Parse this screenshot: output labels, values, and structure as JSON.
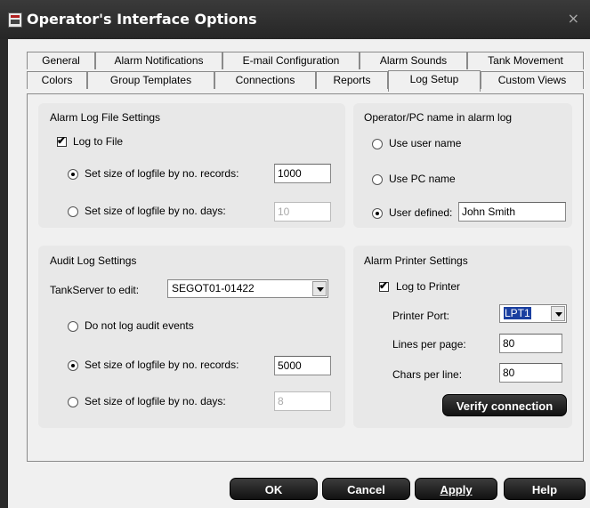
{
  "window": {
    "title": "Operator's Interface Options",
    "close_label": "×"
  },
  "tabs_top": [
    "General",
    "Alarm Notifications",
    "E-mail Configuration",
    "Alarm Sounds",
    "Tank Movement"
  ],
  "tabs_bottom": [
    "Colors",
    "Group Templates",
    "Connections",
    "Reports",
    "Log Setup",
    "Custom Views"
  ],
  "active_tab": "Log Setup",
  "alarm_log": {
    "heading": "Alarm Log File Settings",
    "log_to_file_label": "Log to File",
    "log_to_file_checked": true,
    "by_records_label": "Set size of logfile by no. records:",
    "by_records_value": "1000",
    "by_days_label": "Set size of logfile by no. days:",
    "by_days_value": "10"
  },
  "operator_name": {
    "heading": "Operator/PC name in alarm log",
    "user_name_label": "Use user name",
    "pc_name_label": "Use PC name",
    "user_defined_label": "User defined:",
    "user_defined_value": "John Smith"
  },
  "audit_log": {
    "heading": "Audit Log Settings",
    "tankserver_label": "TankServer to edit:",
    "tankserver_value": "SEGOT01-01422",
    "no_log_label": "Do not log audit events",
    "by_records_label": "Set size of logfile by no. records:",
    "by_records_value": "5000",
    "by_days_label": "Set size of logfile by no. days:",
    "by_days_value": "8"
  },
  "printer": {
    "heading": "Alarm Printer Settings",
    "log_to_printer_label": "Log to Printer",
    "log_to_printer_checked": true,
    "port_label": "Printer Port:",
    "port_value": "LPT1",
    "lines_label": "Lines per page:",
    "lines_value": "80",
    "chars_label": "Chars per line:",
    "chars_value": "80",
    "verify_label": "Verify connection"
  },
  "footer": {
    "ok": "OK",
    "cancel": "Cancel",
    "apply": "Apply",
    "help": "Help"
  },
  "check_mark": "✔"
}
